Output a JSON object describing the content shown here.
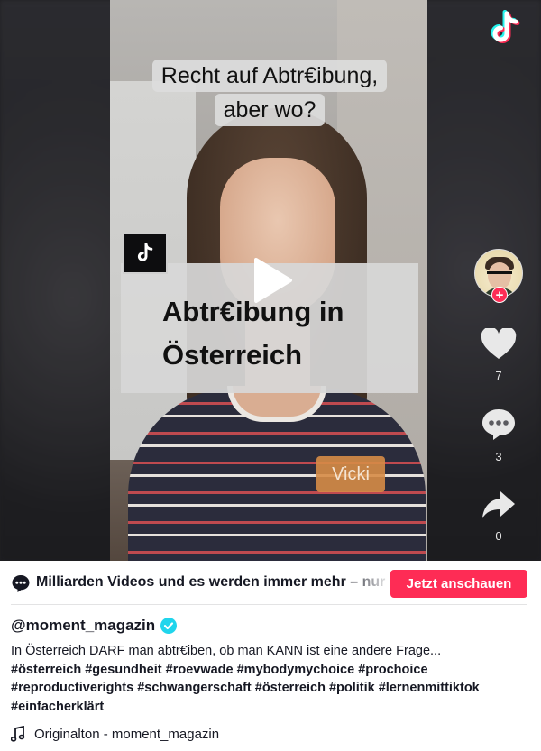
{
  "video": {
    "caption_top_line1": "Recht auf Abtr€ibung,",
    "caption_top_line2": "aber wo?",
    "title_line1": "Abtr€ibung in",
    "title_line2": "Österreich",
    "name_tag": "Vicki"
  },
  "actions": {
    "likes": "7",
    "comments": "3",
    "shares": "0"
  },
  "promo": {
    "text": "Milliarden Videos und es werden immer mehr – nur auf TikTok",
    "button": "Jetzt anschauen",
    "button_color": "#fe2c55"
  },
  "post": {
    "username": "@moment_magazin",
    "verified_color": "#20d5ec",
    "description": "In Österreich DARF man abtr€iben, ob man KANN ist eine andere Frage...",
    "hashtags_line1": "#österreich #gesundheit #roevwade #mybodymychoice #prochoice",
    "hashtags_line2": "#reproductiverights #schwangerschaft #österreich #politik #lernenmittiktok",
    "hashtags_line3": "#einfacherklärt",
    "sound": "Originalton - moment_magazin"
  },
  "icons": {
    "play": "play-icon",
    "logo": "tiktok-logo-icon",
    "like": "heart-icon",
    "comment": "comment-icon",
    "share": "share-icon",
    "music": "music-note-icon"
  }
}
